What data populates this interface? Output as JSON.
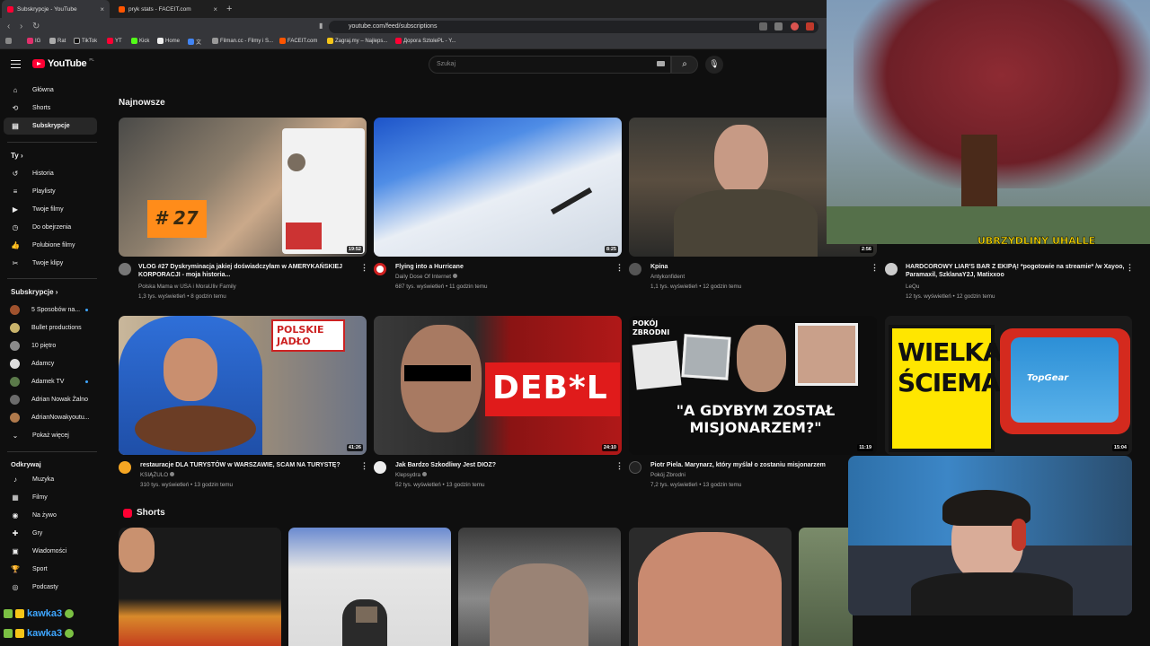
{
  "browser": {
    "tabs": [
      {
        "title": "Subskrypcje - YouTube",
        "active": true
      },
      {
        "title": "pryk stats - FACEIT.com",
        "active": false
      }
    ],
    "url": "youtube.com/feed/subscriptions",
    "bookmarks": [
      "IG",
      "Rat",
      "TikTok",
      "YT",
      "Kick",
      "Home",
      "文",
      "Filman.cc - Filmy i S...",
      "FACEIT.com",
      "Zagraj.my – Najleps...",
      "Дорога SztolePL - Y..."
    ]
  },
  "masthead": {
    "logo": "YouTube",
    "country": "PL",
    "search_placeholder": "Szukaj"
  },
  "sidebar": {
    "main": [
      {
        "label": "Główna",
        "icon": "home-icon"
      },
      {
        "label": "Shorts",
        "icon": "shorts-icon"
      },
      {
        "label": "Subskrypcje",
        "icon": "subscriptions-icon",
        "active": true
      }
    ],
    "you_header": "Ty",
    "you": [
      {
        "label": "Historia",
        "icon": "history-icon"
      },
      {
        "label": "Playlisty",
        "icon": "playlists-icon"
      },
      {
        "label": "Twoje filmy",
        "icon": "your-videos-icon"
      },
      {
        "label": "Do obejrzenia",
        "icon": "watch-later-icon"
      },
      {
        "label": "Polubione filmy",
        "icon": "liked-icon"
      },
      {
        "label": "Twoje klipy",
        "icon": "clips-icon"
      }
    ],
    "subs_header": "Subskrypcje",
    "subs": [
      {
        "label": "5 Sposobów na...",
        "color": "#a0522d",
        "dot": true
      },
      {
        "label": "Bullet productions",
        "color": "#c9b36b",
        "dot": false
      },
      {
        "label": "10 piętro",
        "color": "#8a8a8a",
        "dot": false
      },
      {
        "label": "Adamcy",
        "color": "#dddddd",
        "dot": false
      },
      {
        "label": "Adamek TV",
        "color": "#5b7a4a",
        "dot": true
      },
      {
        "label": "Adrian Nowak Żalno",
        "color": "#6b6b6b",
        "dot": false
      },
      {
        "label": "AdrianNowakyoutu...",
        "color": "#b07a4c",
        "dot": false
      }
    ],
    "show_more": "Pokaż więcej",
    "explore_header": "Odkrywaj",
    "explore": [
      {
        "label": "Muzyka",
        "icon": "music-icon"
      },
      {
        "label": "Filmy",
        "icon": "movies-icon"
      },
      {
        "label": "Na żywo",
        "icon": "live-icon"
      },
      {
        "label": "Gry",
        "icon": "gaming-icon"
      },
      {
        "label": "Wiadomości",
        "icon": "news-icon"
      },
      {
        "label": "Sport",
        "icon": "sport-icon"
      },
      {
        "label": "Podcasty",
        "icon": "podcasts-icon"
      }
    ]
  },
  "main": {
    "latest_title": "Najnowsze",
    "row1": [
      {
        "title": "VLOG #27 Dyskryminacja jakiej doświadczyłam w AMERYKAŃSKIEJ KORPORACJI - moja historia...",
        "channel": "Polska Mama w USA i MoraUliv Family",
        "meta": "1,3 tys. wyświetleń • 8 godzin temu",
        "duration": "19:52",
        "overlay": "# 27"
      },
      {
        "title": "Flying into a Hurricane",
        "channel": "Daily Dose Of Internet",
        "meta": "687 tys. wyświetleń • 11 godzin temu",
        "duration": "8:25",
        "verified": true
      },
      {
        "title": "Kpina",
        "channel": "Antykonfident",
        "meta": "1,1 tys. wyświetleń • 12 godzin temu",
        "duration": "2:56"
      },
      {
        "title": "HARDCOROWY LIAR'S BAR Z EKIPĄ! *pogotowie na streamie* /w Xayoo, Paramaxil, SzklanaY2J, Matixxoo",
        "channel": "LeQu",
        "meta": "12 tys. wyświetleń • 12 godzin temu",
        "duration": "38:57"
      }
    ],
    "row2": [
      {
        "title": "restauracje DLA TURYSTÓW w WARSZAWIE, SCAM NA TURYSTĘ?",
        "channel": "KSIĄŻULO",
        "meta": "310 tys. wyświetleń • 13 godzin temu",
        "duration": "41:26",
        "verified": true,
        "overlay": "POLSKIE JADŁO"
      },
      {
        "title": "Jak Bardzo Szkodliwy Jest DIOZ?",
        "channel": "Klepsydra",
        "meta": "52 tys. wyświetleń • 13 godzin temu",
        "duration": "24:10",
        "verified": true,
        "overlay": "DEB*L"
      },
      {
        "title": "Piotr Piela. Marynarz, który myślał o zostaniu misjonarzem",
        "channel": "Pokój Zbrodni",
        "meta": "7,2 tys. wyświetleń • 13 godzin temu",
        "duration": "11:19",
        "overlay": "\"A GDYBYM ZOSTAŁ MISJONARZEM?\"",
        "overlay_top": "POKÓJ ZBRODNI"
      },
      {
        "title": "",
        "channel": "",
        "meta": "",
        "duration": "15:04",
        "overlay": "WIELKA ŚCIEMA?",
        "overlay_tv": "TopGear"
      }
    ],
    "shorts_title": "Shorts"
  },
  "overlays": {
    "game_banner": "UBRZYDLINY UHALLE",
    "chat": [
      "kawka3",
      "kawka3"
    ]
  },
  "colors": {
    "background": "#0f0f0f",
    "brand_red": "#ff0033",
    "link_blue": "#3ea6ff"
  }
}
